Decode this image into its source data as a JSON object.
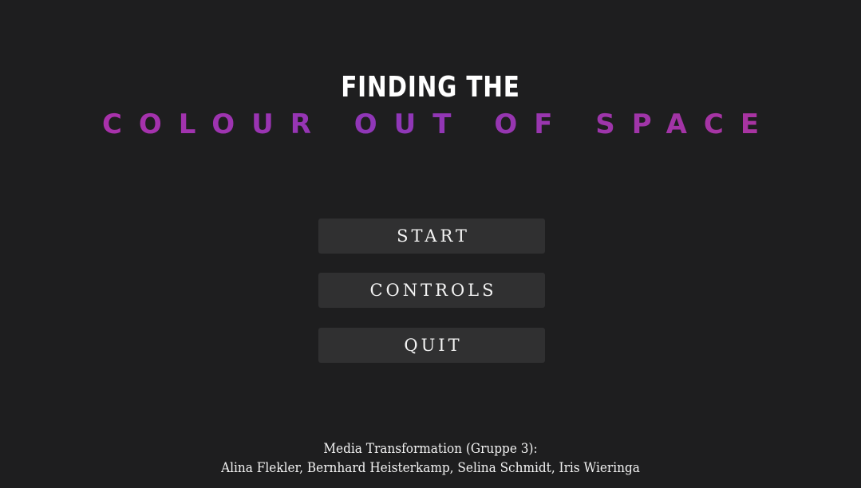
{
  "title": {
    "line1": "FINDING THE",
    "line2": "COLOUR OUT OF SPACE"
  },
  "menu": {
    "start_label": "START",
    "controls_label": "CONTROLS",
    "quit_label": "QUIT"
  },
  "credits": {
    "group": "Media Transformation (Gruppe 3):",
    "authors": "Alina Flekler, Bernhard Heisterkamp, Selina Schmidt, Iris Wieringa"
  },
  "colors": {
    "background": "#1e1e1f",
    "button": "#303031",
    "title_gradient_start": "#b32fa6",
    "title_gradient_end": "#8e37b8"
  }
}
